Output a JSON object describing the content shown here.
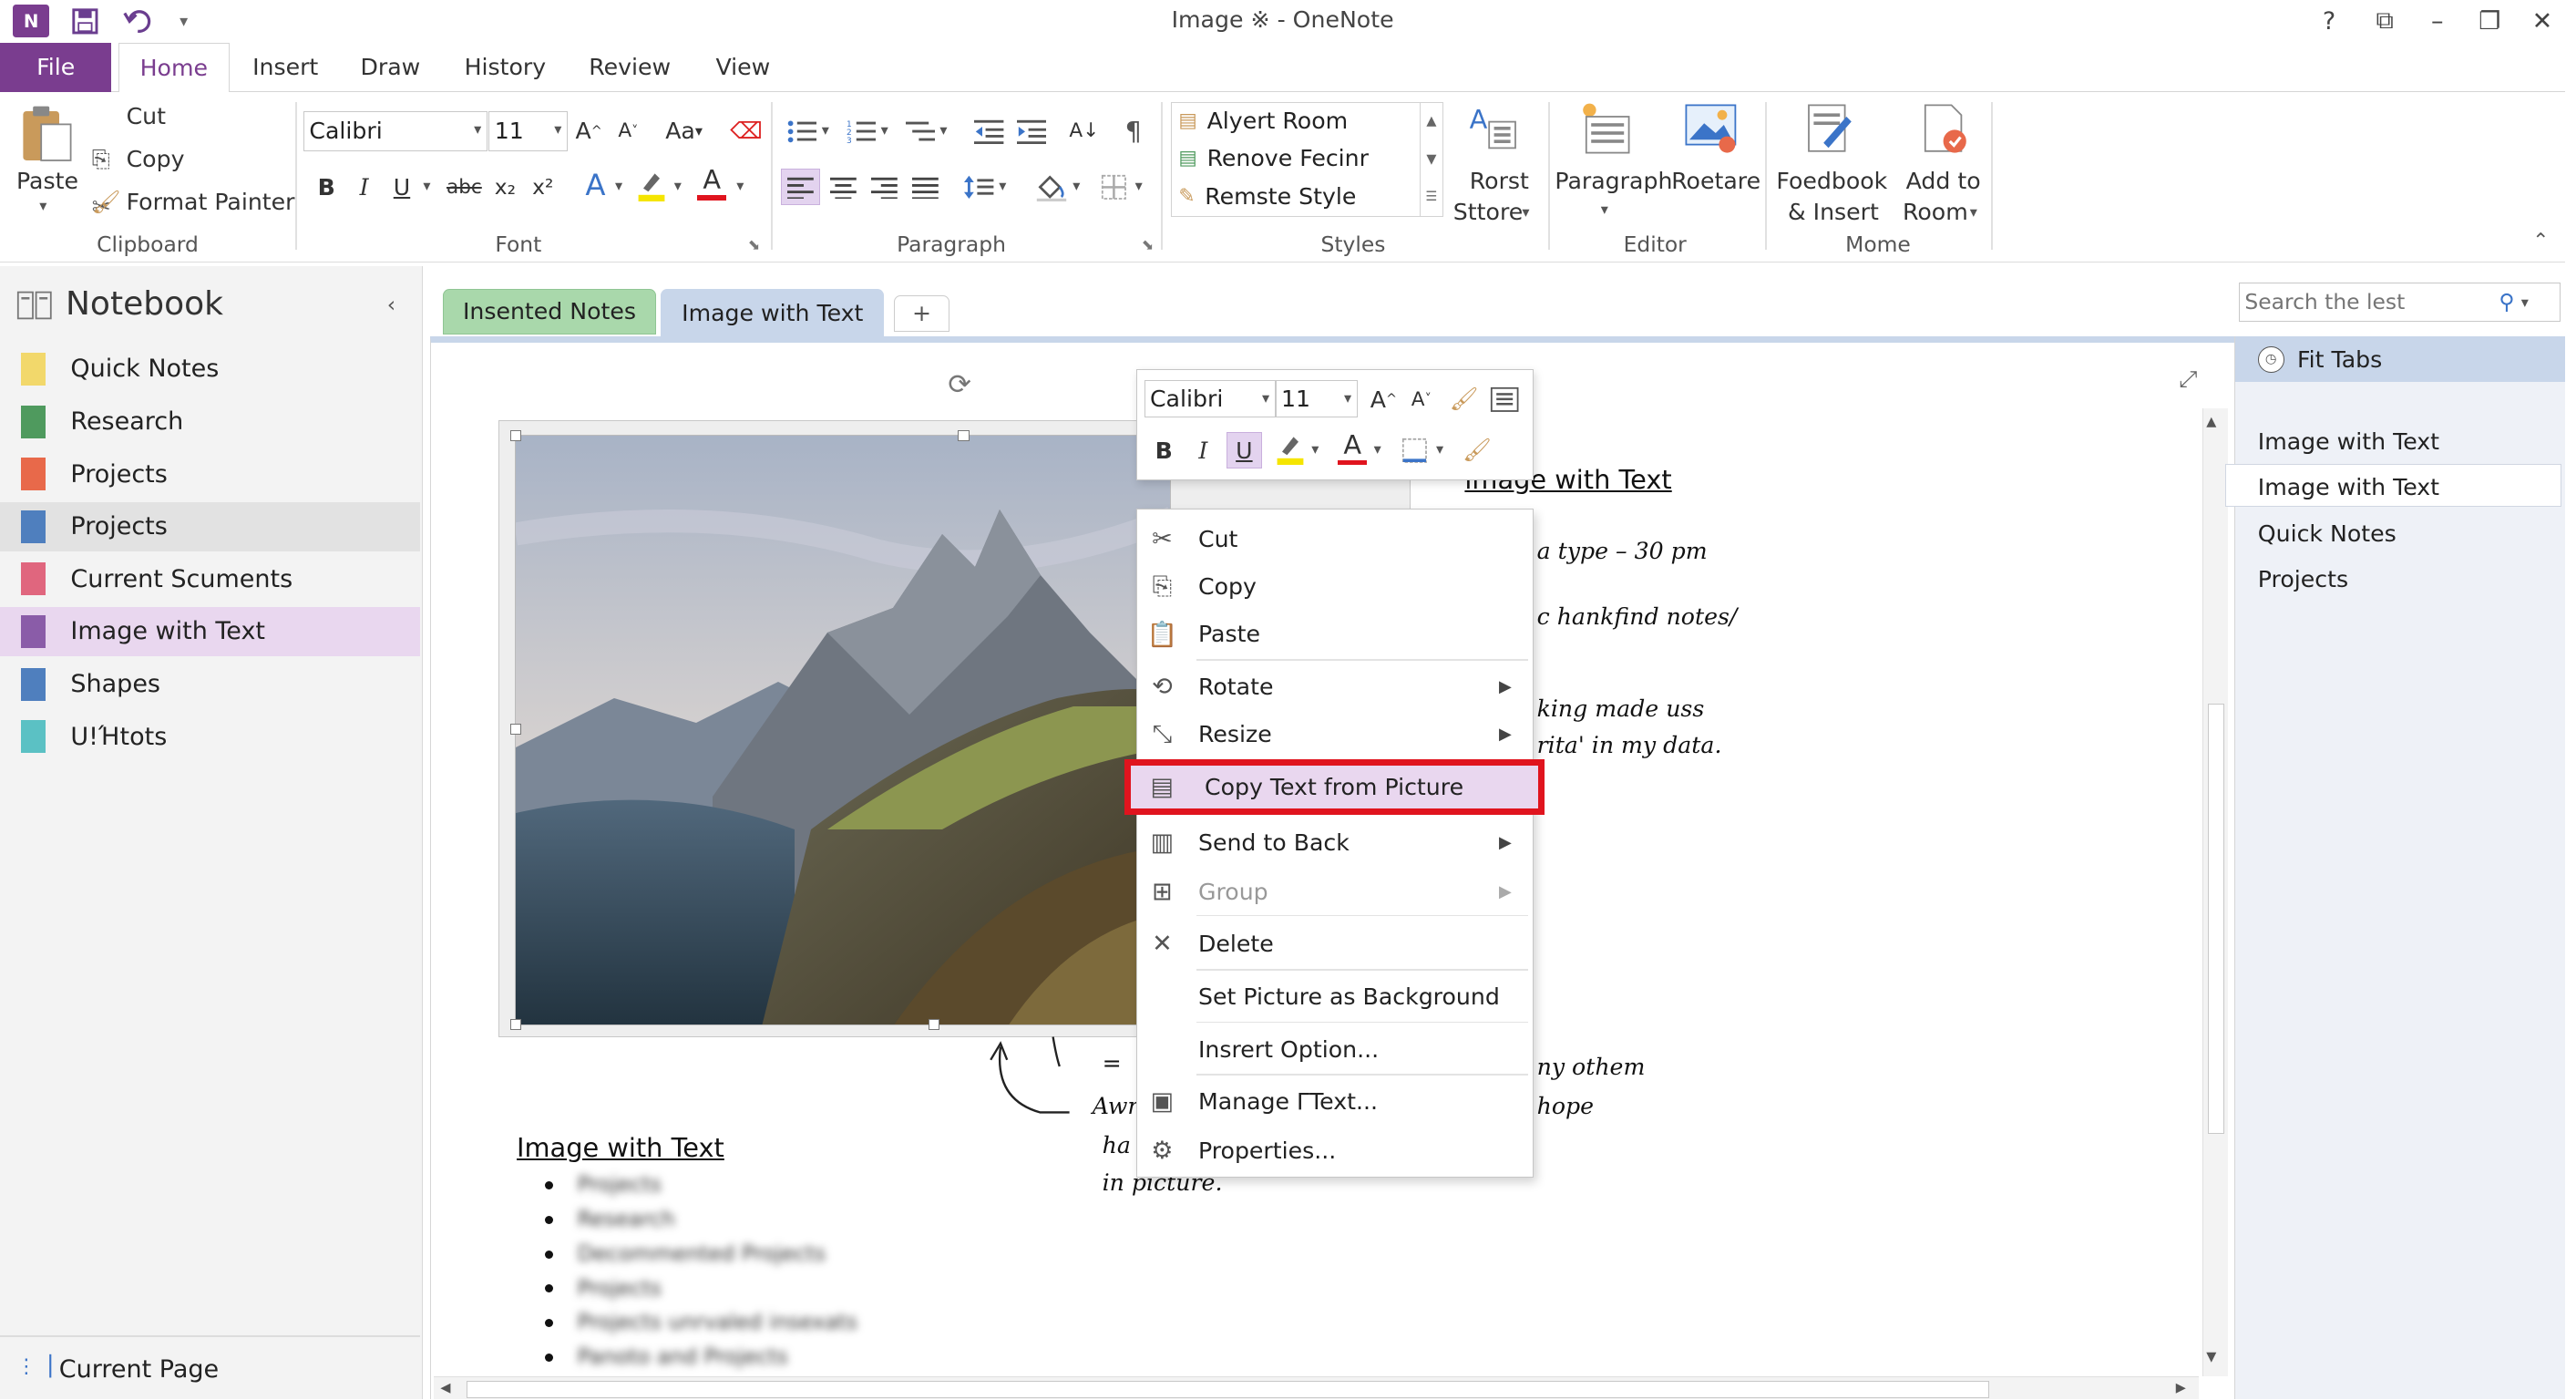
{
  "window": {
    "title": "Image ※ - OneNote",
    "help": "?",
    "restore_icon": "⧉",
    "minimize": "–",
    "maximize": "❐",
    "close": "✕"
  },
  "tabs": {
    "file": "File",
    "home": "Home",
    "insert": "Insert",
    "draw": "Draw",
    "history": "History",
    "review": "Review",
    "view": "View"
  },
  "ribbon": {
    "clipboard": {
      "paste": "Paste",
      "cut": "Cut",
      "copy": "Copy",
      "format_painter": "Format Painter",
      "label": "Clipboard"
    },
    "font": {
      "family": "Calibri",
      "size": "11",
      "label": "Font",
      "bold": "B",
      "italic": "I",
      "underline": "U",
      "strike": "abc",
      "sub": "x₂",
      "sup": "x²",
      "grow": "A^",
      "shrink": "A˅",
      "change_case": "Aa"
    },
    "paragraph": {
      "label": "Paragraph"
    },
    "styles": {
      "items": [
        "Alyert Room",
        "Renove Fecinr",
        "Remste Style"
      ],
      "label": "Styles",
      "rorst": "Rorst",
      "sttore": "Sttore"
    },
    "editor": {
      "paragraph": "Paragraph",
      "roetare": "Roetare",
      "label": "Editor"
    },
    "mome": {
      "feedbook": "Foedbook",
      "insert": "& Insert",
      "add_to": "Add to",
      "room": "Room",
      "label": "Mome"
    }
  },
  "nav": {
    "title": "Notebook",
    "items": [
      {
        "label": "Quick Notes",
        "color": "#f2d86b"
      },
      {
        "label": "Research",
        "color": "#4f9a5e"
      },
      {
        "label": "Projects",
        "color": "#e8694a"
      },
      {
        "label": "Projects",
        "color": "#4f7fbe"
      },
      {
        "label": "Current Scuments",
        "color": "#e0667e"
      },
      {
        "label": "Image with Text",
        "color": "#8a5ca8"
      },
      {
        "label": "Shapes",
        "color": "#4f7fbe"
      },
      {
        "label": "U!Ήtots",
        "color": "#5bc1c4"
      }
    ],
    "footer": "Current Page"
  },
  "page_tabs": {
    "first": "Insented Notes",
    "second": "Image with Text",
    "add": "+"
  },
  "search": {
    "placeholder": "Search the lest"
  },
  "right_pane": {
    "header": "Fit Tabs",
    "pages": [
      "Image with Text",
      "Image with Text",
      "Quick Notes",
      "Projects"
    ]
  },
  "mini_toolbar": {
    "font": "Calibri",
    "size": "11",
    "bold": "B",
    "italic": "I",
    "underline": "U",
    "grow": "A^",
    "shrink": "A˅"
  },
  "context_menu": {
    "items": [
      "Cut",
      "Copy",
      "Paste",
      "Rotate",
      "Resize",
      "Copy Text from Picture",
      "Send to Back",
      "Group",
      "Delete",
      "Set Picture as Background",
      "Insrert Option...",
      "Manage ΓText...",
      "Properties..."
    ],
    "highlight_color": "#e0141e"
  },
  "note": {
    "heading": "ımage with Text",
    "line1": "a  type  – 30  pm",
    "line2": "c   hankfind  notes/",
    "line3": "king  made  uss",
    "line4": "rita'  in  my  data.",
    "line5": "ny  othem",
    "line6": "hope",
    "ann1": "Awr",
    "ann2": "ha",
    "ann3": "in  picture.",
    "dash": "="
  },
  "page_content": {
    "heading": "Image with Text",
    "bullets": [
      "Projects",
      "Research",
      "Decommented Projects",
      "Projects",
      "Projects unrvaled insexats",
      "Panoto and Projects"
    ]
  },
  "accent": "#7a3d8f"
}
